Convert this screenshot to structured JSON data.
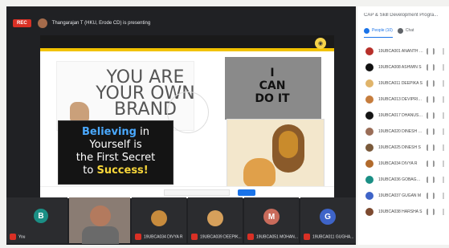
{
  "meet": {
    "rec_label": "REC",
    "presenter_caption": "Thangarajan T (HKU, Erode CD) is presenting",
    "panel_title": "CAP & Skill Development Progra...",
    "tabs": [
      {
        "label": "People (10)"
      },
      {
        "label": "Chat"
      }
    ],
    "people": [
      {
        "name": "19UBCA001 ANANTH DB",
        "color": "#b7302a"
      },
      {
        "name": "19UBCA008 ASHWIN S",
        "color": "#111111"
      },
      {
        "name": "19UBCA011 DEEPIKA S",
        "color": "#e0b46a"
      },
      {
        "name": "19UBCA013 DEVIPRIYA S",
        "color": "#c67d3d"
      },
      {
        "name": "19UBCA017 DHANUSH S",
        "color": "#151515"
      },
      {
        "name": "19UBCA020 DINESH KU...",
        "color": "#9a6d57"
      },
      {
        "name": "19UBCA025 DINESH S",
        "color": "#7a5a3b"
      },
      {
        "name": "19UBCA034 DIVYA R",
        "color": "#b16a2c"
      },
      {
        "name": "19UBCA036 GOBAGUA...",
        "color": "#1b8f85"
      },
      {
        "name": "19UBCA037 GUGAN M",
        "color": "#3e64c8"
      },
      {
        "name": "19UBCA038 HARSHA S",
        "color": "#7d4a30"
      }
    ],
    "tiles": [
      {
        "initial": "B",
        "name": "You"
      },
      {
        "initial": "",
        "name": ""
      },
      {
        "initial": "",
        "name": "19UBCA034 DIVYA R"
      },
      {
        "initial": "",
        "name": "19UBCA039 DEEPIK..."
      },
      {
        "initial": "M",
        "name": "19UBCA051 MOHAN..."
      },
      {
        "initial": "G",
        "name": "19UBCA011 GUGHA..."
      }
    ]
  },
  "slide": {
    "brand_lines": [
      "YOU ARE",
      "YOUR OWN",
      "BRAND"
    ],
    "chalk_lines": [
      {
        "text": "Believing",
        "style": "b"
      },
      {
        "text": "in",
        "style": ""
      },
      {
        "text": "Yourself is",
        "style": ""
      },
      {
        "text": "the First Secret",
        "style": ""
      },
      {
        "text": "to",
        "style": ""
      },
      {
        "text": "Success!",
        "style": "s"
      }
    ],
    "icant_lines": [
      "I",
      "CAN",
      "DO IT"
    ]
  }
}
